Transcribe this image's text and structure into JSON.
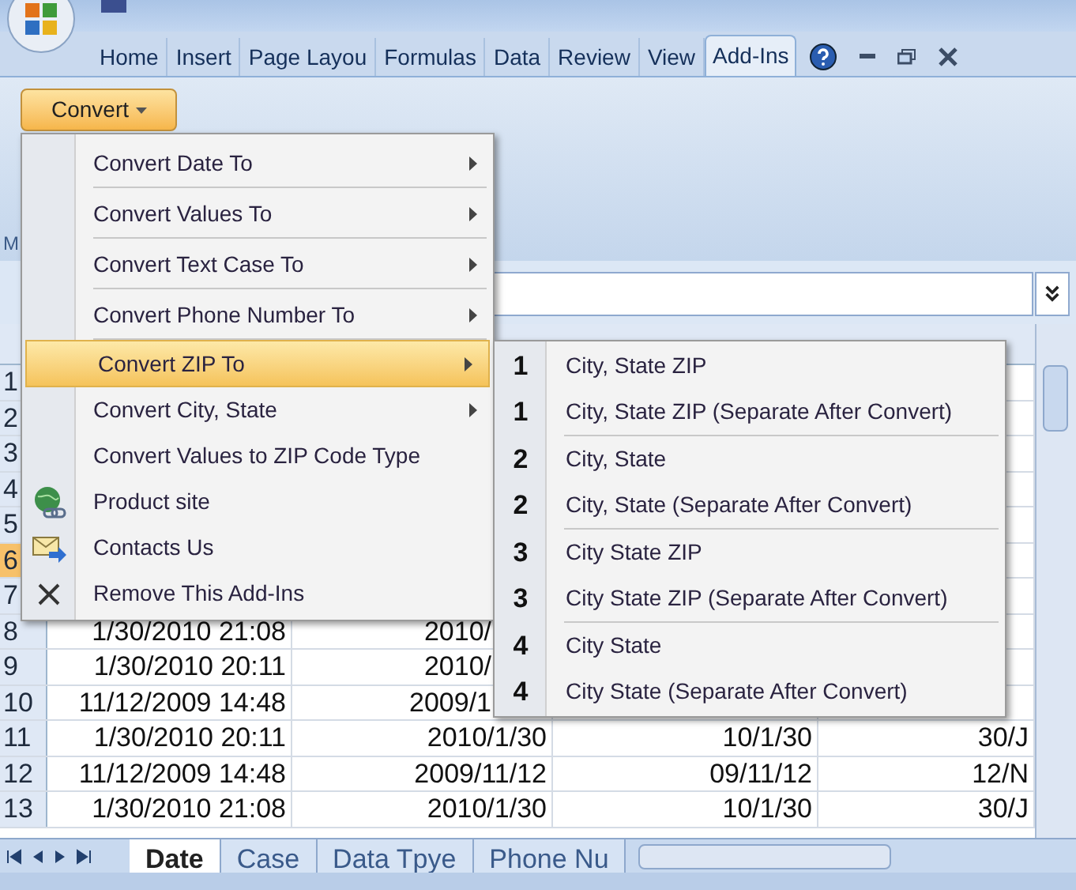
{
  "ribbon_tabs": [
    {
      "label": "Home",
      "selected": false
    },
    {
      "label": "Insert",
      "selected": false
    },
    {
      "label": "Page Layou",
      "selected": false
    },
    {
      "label": "Formulas",
      "selected": false
    },
    {
      "label": "Data",
      "selected": false
    },
    {
      "label": "Review",
      "selected": false
    },
    {
      "label": "View",
      "selected": false
    },
    {
      "label": "Add-Ins",
      "selected": true
    }
  ],
  "ribbon": {
    "convert_button": "Convert",
    "group_label": "M"
  },
  "menu": {
    "items": [
      {
        "label": "Convert Date To",
        "kind": "submenu",
        "selected": false
      },
      {
        "label": "Convert Values To",
        "kind": "submenu",
        "selected": false
      },
      {
        "label": "Convert Text Case To",
        "kind": "submenu",
        "selected": false
      },
      {
        "label": "Convert Phone Number To",
        "kind": "submenu",
        "selected": false
      },
      {
        "label": "Convert ZIP To",
        "kind": "submenu",
        "selected": true
      },
      {
        "label": "Convert City, State",
        "kind": "submenu",
        "selected": false
      },
      {
        "label": "Convert Values to ZIP Code Type",
        "kind": "command",
        "selected": false
      },
      {
        "label": "Product site",
        "kind": "site",
        "selected": false
      },
      {
        "label": "Contacts Us",
        "kind": "contact",
        "selected": false
      },
      {
        "label": "Remove This Add-Ins",
        "kind": "remove",
        "selected": false
      }
    ]
  },
  "submenu": {
    "groups": [
      {
        "items": [
          {
            "number": "1",
            "label": "City, State ZIP"
          },
          {
            "number": "1",
            "label": "City, State ZIP (Separate After Convert)"
          }
        ]
      },
      {
        "items": [
          {
            "number": "2",
            "label": "City, State"
          },
          {
            "number": "2",
            "label": "City, State (Separate After Convert)"
          }
        ]
      },
      {
        "items": [
          {
            "number": "3",
            "label": "City State ZIP"
          },
          {
            "number": "3",
            "label": "City State ZIP (Separate After Convert)"
          }
        ]
      },
      {
        "items": [
          {
            "number": "4",
            "label": "City State"
          },
          {
            "number": "4",
            "label": "City State (Separate After Convert)"
          }
        ]
      }
    ]
  },
  "sheet": {
    "rows": [
      {
        "number": "1",
        "selected": false,
        "cells": []
      },
      {
        "number": "2",
        "selected": false,
        "cells": []
      },
      {
        "number": "3",
        "selected": false,
        "cells": []
      },
      {
        "number": "4",
        "selected": false,
        "cells": []
      },
      {
        "number": "5",
        "selected": false,
        "cells": []
      },
      {
        "number": "6",
        "selected": true,
        "cells": []
      },
      {
        "number": "7",
        "selected": false,
        "cells": []
      },
      {
        "number": "8",
        "selected": false,
        "under_submenu": true,
        "cells": [
          "1/30/2010 21:08",
          "2010/"
        ]
      },
      {
        "number": "9",
        "selected": false,
        "under_submenu": true,
        "cells": [
          "1/30/2010 20:11",
          "2010/"
        ]
      },
      {
        "number": "10",
        "selected": false,
        "under_submenu": true,
        "cells": [
          "11/12/2009 14:48",
          "2009/1"
        ]
      },
      {
        "number": "11",
        "selected": false,
        "cells": [
          "1/30/2010 20:11",
          "2010/1/30",
          "10/1/30",
          "30/J"
        ]
      },
      {
        "number": "12",
        "selected": false,
        "cells": [
          "11/12/2009 14:48",
          "2009/11/12",
          "09/11/12",
          "12/N"
        ]
      },
      {
        "number": "13",
        "selected": false,
        "cells": [
          "1/30/2010 21:08",
          "2010/1/30",
          "10/1/30",
          "30/J"
        ]
      }
    ]
  },
  "sheet_tabs": [
    {
      "label": "Date",
      "selected": true
    },
    {
      "label": "Case",
      "selected": false
    },
    {
      "label": "Data Tpye",
      "selected": false
    },
    {
      "label": "Phone Nu",
      "selected": false
    }
  ]
}
